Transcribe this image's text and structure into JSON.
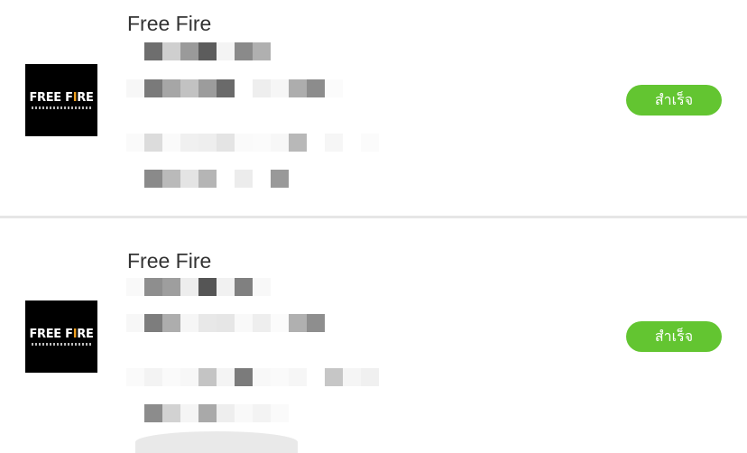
{
  "orders": [
    {
      "app_name": "Free Fire",
      "icon": {
        "name": "free-fire-logo-icon",
        "text_main": "FREE F",
        "text_accent": "I",
        "text_end": "RE"
      },
      "status": "สำเร็จ"
    },
    {
      "app_name": "Free Fire",
      "icon": {
        "name": "free-fire-logo-icon",
        "text_main": "FREE F",
        "text_accent": "I",
        "text_end": "RE"
      },
      "status": "สำเร็จ"
    }
  ],
  "colors": {
    "status_button": "#63c531",
    "divider": "#e6e6e6",
    "title_text": "#333333"
  }
}
